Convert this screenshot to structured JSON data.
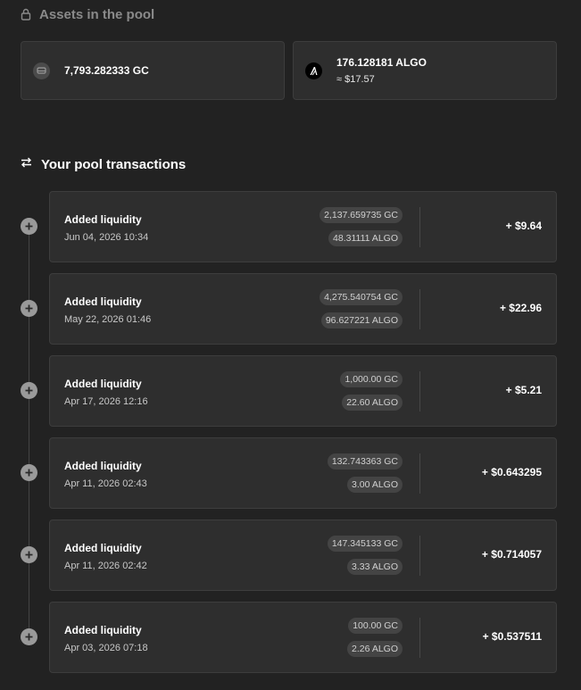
{
  "assets": {
    "title": "Assets in the pool",
    "gc": {
      "amount": "7,793.282333 GC",
      "icon": "gc-token-icon"
    },
    "algo": {
      "amount": "176.128181 ALGO",
      "usd": "≈ $17.57",
      "icon": "algorand-logo-icon"
    }
  },
  "transactions": {
    "title": "Your pool transactions",
    "items": [
      {
        "label": "Added liquidity",
        "date": "Jun 04, 2026 10:34",
        "gc": "2,137.659735 GC",
        "algo": "48.31111 ALGO",
        "usd": "+ $9.64"
      },
      {
        "label": "Added liquidity",
        "date": "May 22, 2026 01:46",
        "gc": "4,275.540754 GC",
        "algo": "96.627221 ALGO",
        "usd": "+ $22.96"
      },
      {
        "label": "Added liquidity",
        "date": "Apr 17, 2026 12:16",
        "gc": "1,000.00 GC",
        "algo": "22.60 ALGO",
        "usd": "+ $5.21"
      },
      {
        "label": "Added liquidity",
        "date": "Apr 11, 2026 02:43",
        "gc": "132.743363 GC",
        "algo": "3.00 ALGO",
        "usd": "+ $0.643295"
      },
      {
        "label": "Added liquidity",
        "date": "Apr 11, 2026 02:42",
        "gc": "147.345133 GC",
        "algo": "3.33 ALGO",
        "usd": "+ $0.714057"
      },
      {
        "label": "Added liquidity",
        "date": "Apr 03, 2026 07:18",
        "gc": "100.00 GC",
        "algo": "2.26 ALGO",
        "usd": "+ $0.537511"
      }
    ]
  },
  "colors": {
    "background": "#222222",
    "card": "#2e2e2e",
    "pill": "#444444",
    "muted_text": "#8a8a8a"
  }
}
